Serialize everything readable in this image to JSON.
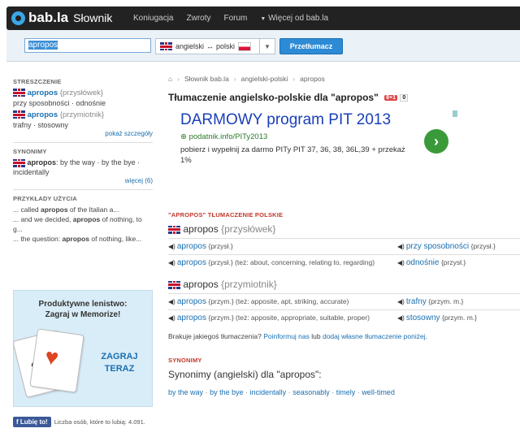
{
  "header": {
    "logo_text": "bab.la",
    "logo_sub": "Słownik",
    "nav": [
      "Koniugacja",
      "Zwroty",
      "Forum"
    ],
    "more": "Więcej od bab.la"
  },
  "search": {
    "value": "apropos",
    "lang_from": "angielski",
    "lang_arrow": "↔",
    "lang_to": "polski",
    "button": "Przetłumacz"
  },
  "sidebar": {
    "summary_head": "STRESZCZENIE",
    "summary": [
      {
        "word": "apropos",
        "pos": "{przysłówek}",
        "trans": "przy sposobności · odnośnie"
      },
      {
        "word": "apropos",
        "pos": "{przymiotnik}",
        "trans": "trafny · stosowny"
      }
    ],
    "details_link": "pokaż szczegóły",
    "syn_head": "SYNONIMY",
    "syn_word": "apropos",
    "syn_text": ": by the way · by the bye · incidentally",
    "more_link": "więcej (6)",
    "usage_head": "PRZYKŁADY UŻYCIA",
    "usage": [
      {
        "pre": "... called ",
        "b": "apropos",
        "post": " of the Italian a..."
      },
      {
        "pre": "... and we decided, ",
        "b": "apropos",
        "post": " of nothing, to g..."
      },
      {
        "pre": "... the question: ",
        "b": "apropos",
        "post": " of nothing, like..."
      }
    ]
  },
  "memorize": {
    "title1": "Produktywne lenistwo:",
    "title2": "Zagraj w Memorize!",
    "cta1": "ZAGRAJ",
    "cta2": "TERAZ"
  },
  "facebook": {
    "button": "Lubię to!",
    "text": "Liczba osób, które to lubią: 4.091."
  },
  "breadcrumb": [
    "Słownik bab.la",
    "angielski-polski",
    "apropos"
  ],
  "title": "Tłumaczenie angielsko-polskie dla \"apropos\"",
  "gplus": "8+1",
  "gcount": "0",
  "ad": {
    "title": "DARMOWY program PIT 2013",
    "url": "podatnik.info/PITy2013",
    "desc": "pobierz i wypełnij za darmo PITy PIT 37, 36, 38, 36L,39 + przekaż 1%"
  },
  "translations": {
    "label": "\"APROPOS\" TŁUMACZENIE POLSKIE",
    "groups": [
      {
        "word": "apropos",
        "pos": "{przysłówek}",
        "rows": [
          {
            "src": "apropos",
            "src_g": "{przysł.}",
            "src_extra": "",
            "tgt": "przy sposobności",
            "tgt_g": "{przysł.}"
          },
          {
            "src": "apropos",
            "src_g": "{przysł.}",
            "src_extra": " (też: about, concerning, relating to, regarding)",
            "tgt": "odnośnie",
            "tgt_g": "{przysł.}"
          }
        ]
      },
      {
        "word": "apropos",
        "pos": "{przymiotnik}",
        "rows": [
          {
            "src": "apropos",
            "src_g": "{przym.}",
            "src_extra": " (też: apposite, apt, striking, accurate)",
            "tgt": "trafny",
            "tgt_g": "{przym. m.}"
          },
          {
            "src": "apropos",
            "src_g": "{przym.}",
            "src_extra": " (też: apposite, appropriate, suitable, proper)",
            "tgt": "stosowny",
            "tgt_g": "{przym. m.}"
          }
        ]
      }
    ],
    "missing_pre": "Brakuje jakiegoś tłumaczenia? ",
    "missing_link1": "Poinformuj nas",
    "missing_mid": " lub ",
    "missing_link2": "dodaj własne tłumaczenie poniżej",
    "missing_post": "."
  },
  "synonyms": {
    "label": "SYNONIMY",
    "heading": "Synonimy (angielski) dla \"apropos\":",
    "items": [
      "by the way",
      "by the bye",
      "incidentally",
      "seasonably",
      "timely",
      "well-timed"
    ]
  }
}
